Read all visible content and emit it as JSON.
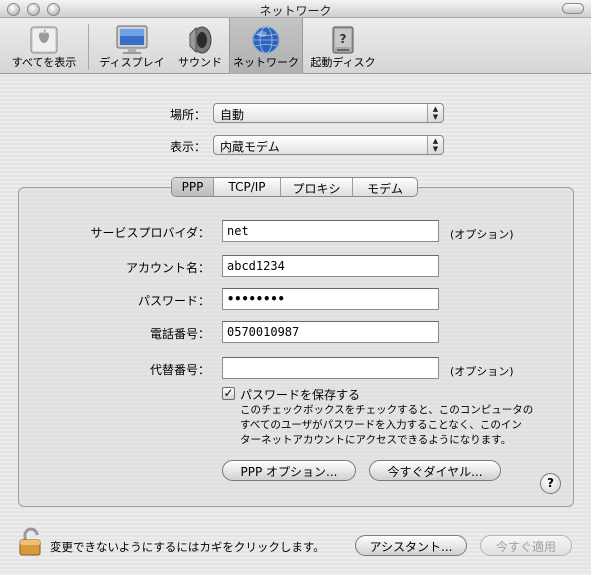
{
  "window": {
    "title": "ネットワーク"
  },
  "toolbar": {
    "items": [
      {
        "label": "すべてを表示",
        "icon": "apple-grid-icon"
      },
      {
        "label": "ディスプレイ",
        "icon": "display-icon"
      },
      {
        "label": "サウンド",
        "icon": "speaker-icon"
      },
      {
        "label": "ネットワーク",
        "icon": "globe-icon",
        "selected": true
      },
      {
        "label": "起動ディスク",
        "icon": "startup-disk-icon"
      }
    ]
  },
  "location": {
    "label": "場所：",
    "value": "自動"
  },
  "show": {
    "label": "表示：",
    "value": "内蔵モデム"
  },
  "tabs": [
    {
      "label": "PPP",
      "active": true
    },
    {
      "label": "TCP/IP"
    },
    {
      "label": "プロキシ"
    },
    {
      "label": "モデム"
    }
  ],
  "form": {
    "service_provider": {
      "label": "サービスプロバイダ：",
      "value": "net",
      "note": "(オプション)"
    },
    "account_name": {
      "label": "アカウント名：",
      "value": "abcd1234"
    },
    "password": {
      "label": "パスワード：",
      "value": "••••••••"
    },
    "phone": {
      "label": "電話番号：",
      "value": "0570010987"
    },
    "alt_phone": {
      "label": "代替番号：",
      "value": "",
      "note": "(オプション)"
    },
    "save_password": {
      "label": "パスワードを保存する",
      "checked": true,
      "description_lines": [
        "このチェックボックスをチェックすると、このコンピュータの",
        "すべてのユーザがパスワードを入力することなく、このイン",
        "ターネットアカウントにアクセスできるようになります。"
      ]
    },
    "ppp_options_button": "PPP オプション...",
    "dial_now_button": "今すぐダイヤル...",
    "help_button": "?"
  },
  "footer": {
    "lock_message": "変更できないようにするにはカギをクリックします。",
    "assistant_button": "アシスタント...",
    "apply_button": "今すぐ適用"
  }
}
